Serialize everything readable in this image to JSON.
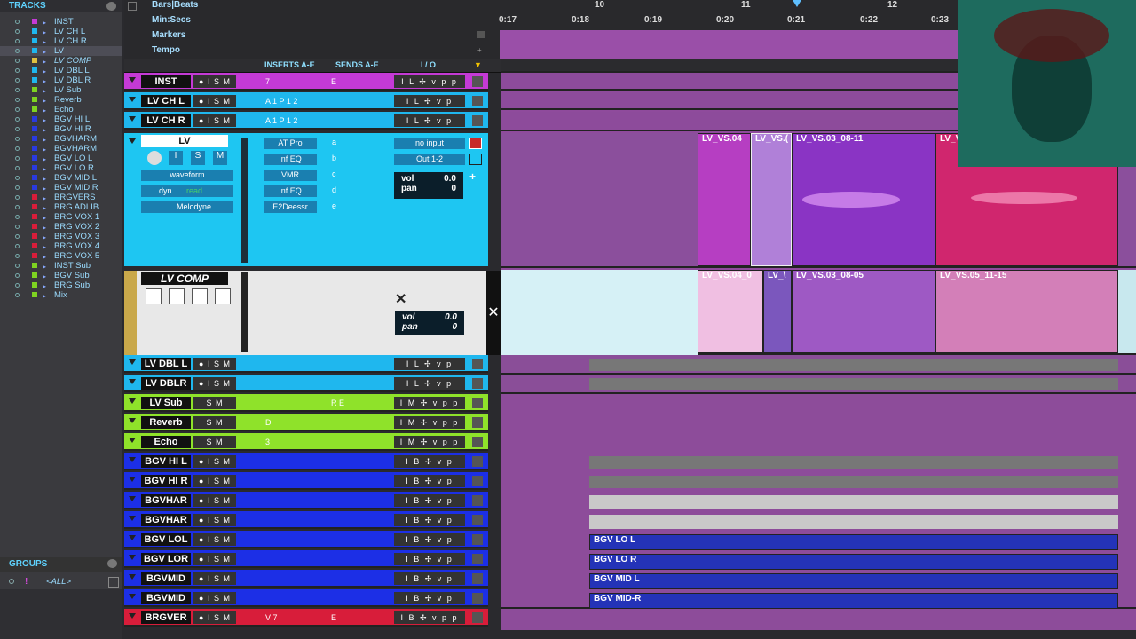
{
  "tracks_panel": {
    "title": "TRACKS",
    "items": [
      {
        "label": "INST",
        "color": "#c43ad6"
      },
      {
        "label": "LV CH L",
        "color": "#1fb7ee"
      },
      {
        "label": "LV CH R",
        "color": "#1fb7ee"
      },
      {
        "label": "LV",
        "color": "#1fb7ee"
      },
      {
        "label": "LV COMP",
        "color": "#e0c040"
      },
      {
        "label": "LV DBL L",
        "color": "#1fb7ee"
      },
      {
        "label": "LV DBL R",
        "color": "#1fb7ee"
      },
      {
        "label": "LV Sub",
        "color": "#7ed321"
      },
      {
        "label": "Reverb",
        "color": "#7ed321"
      },
      {
        "label": "Echo",
        "color": "#7ed321"
      },
      {
        "label": "BGV HI L",
        "color": "#2a3ae0"
      },
      {
        "label": "BGV HI R",
        "color": "#2a3ae0"
      },
      {
        "label": "BGVHARM",
        "color": "#2a3ae0"
      },
      {
        "label": "BGVHARM",
        "color": "#2a3ae0"
      },
      {
        "label": "BGV LO L",
        "color": "#2a3ae0"
      },
      {
        "label": "BGV LO R",
        "color": "#2a3ae0"
      },
      {
        "label": "BGV MID L",
        "color": "#2a3ae0"
      },
      {
        "label": "BGV MID R",
        "color": "#2a3ae0"
      },
      {
        "label": "BRGVERS",
        "color": "#d81d3a"
      },
      {
        "label": "BRG ADLIB",
        "color": "#d81d3a"
      },
      {
        "label": "BRG VOX 1",
        "color": "#d81d3a"
      },
      {
        "label": "BRG VOX 2",
        "color": "#d81d3a"
      },
      {
        "label": "BRG VOX 3",
        "color": "#d81d3a"
      },
      {
        "label": "BRG VOX 4",
        "color": "#d81d3a"
      },
      {
        "label": "BRG VOX 5",
        "color": "#d81d3a"
      },
      {
        "label": "INST Sub",
        "color": "#7ed321"
      },
      {
        "label": "BGV Sub",
        "color": "#7ed321"
      },
      {
        "label": "BRG Sub",
        "color": "#7ed321"
      },
      {
        "label": "Mix",
        "color": "#7ed321"
      }
    ]
  },
  "groups_panel": {
    "title": "GROUPS",
    "all_label": "<ALL>"
  },
  "ruler": {
    "bars_beats": "Bars|Beats",
    "min_secs": "Min:Secs",
    "markers": "Markers",
    "tempo": "Tempo",
    "bars": [
      "10",
      "11",
      "12"
    ],
    "secs": [
      "0:17",
      "0:18",
      "0:19",
      "0:20",
      "0:21",
      "0:22",
      "0:23"
    ]
  },
  "columns": {
    "inserts": "INSERTS A-E",
    "sends": "SENDS A-E",
    "io": "I / O"
  },
  "rows": [
    {
      "name": "INST",
      "color": "#c43ad6",
      "ctl": "● I S M",
      "send": "7",
      "send2": "E",
      "io": "I  L  ✢  v  p  p"
    },
    {
      "name": "LV CH L",
      "color": "#1fb7ee",
      "ctl": "● I S M",
      "send": "A 1 P 1 2",
      "send2": "",
      "io": "I  L  ✢  v  p"
    },
    {
      "name": "LV CH R",
      "color": "#1fb7ee",
      "ctl": "● I S M",
      "send": "A 1 P 1 2",
      "send2": "",
      "io": "I  L  ✢  v  p"
    },
    {
      "name": "LV DBL L",
      "color": "#1fb7ee",
      "ctl": "● I S M",
      "send": "",
      "send2": "",
      "io": "I  L  ✢  v  p"
    },
    {
      "name": "LV DBLR",
      "color": "#1fb7ee",
      "ctl": "● I S M",
      "send": "",
      "send2": "",
      "io": "I  L  ✢  v  p"
    },
    {
      "name": "LV Sub",
      "color": "#8fe22a",
      "ctl": "S M",
      "send": "",
      "send2": "R E",
      "io": "I  M  ✢  v  p  p"
    },
    {
      "name": "Reverb",
      "color": "#8fe22a",
      "ctl": "S M",
      "send": "D",
      "send2": "",
      "io": "I  M  ✢  v  p  p"
    },
    {
      "name": "Echo",
      "color": "#8fe22a",
      "ctl": "S M",
      "send": "3",
      "send2": "",
      "io": "I  M  ✢  v  p  p"
    },
    {
      "name": "BGV HI L",
      "color": "#1c2fe6",
      "ctl": "● I S M",
      "send": "",
      "send2": "",
      "io": "I  B  ✢  v  p"
    },
    {
      "name": "BGV HI R",
      "color": "#1c2fe6",
      "ctl": "● I S M",
      "send": "",
      "send2": "",
      "io": "I  B  ✢  v  p"
    },
    {
      "name": "BGVHAR",
      "color": "#1c2fe6",
      "ctl": "● I S M",
      "send": "",
      "send2": "",
      "io": "I  B  ✢  v  p"
    },
    {
      "name": "BGVHAR",
      "color": "#1c2fe6",
      "ctl": "● I S M",
      "send": "",
      "send2": "",
      "io": "I  B  ✢  v  p"
    },
    {
      "name": "BGV LOL",
      "color": "#1c2fe6",
      "ctl": "● I S M",
      "send": "",
      "send2": "",
      "io": "I  B  ✢  v  p"
    },
    {
      "name": "BGV LOR",
      "color": "#1c2fe6",
      "ctl": "● I S M",
      "send": "",
      "send2": "",
      "io": "I  B  ✢  v  p"
    },
    {
      "name": "BGVMID",
      "color": "#1c2fe6",
      "ctl": "● I S M",
      "send": "",
      "send2": "",
      "io": "I  B  ✢  v  p"
    },
    {
      "name": "BGVMID",
      "color": "#1c2fe6",
      "ctl": "● I S M",
      "send": "",
      "send2": "",
      "io": "I  B  ✢  v  p"
    },
    {
      "name": "BRGVER",
      "color": "#d81d3a",
      "ctl": "● I S M",
      "send": "V 7",
      "send2": "E",
      "io": "I  B  ✢  v  p  p"
    }
  ],
  "lv": {
    "name": "LV",
    "view": "waveform",
    "dyn": "dyn",
    "read": "read",
    "plugin": "Melodyne",
    "inserts": [
      "AT Pro",
      "Inf EQ",
      "VMR",
      "Inf EQ",
      "E2Deessr"
    ],
    "insert_letters": [
      "a",
      "b",
      "c",
      "d",
      "e"
    ],
    "input": "no input",
    "output": "Out 1-2",
    "vol_label": "vol",
    "vol": "0.0",
    "pan_label": "pan",
    "pan": "0"
  },
  "lvcomp": {
    "name": "LV COMP",
    "vol_label": "vol",
    "vol": "0.0",
    "pan_label": "pan",
    "pan": "0"
  },
  "clips": {
    "lv": [
      "LV_VS.04",
      "LV_VS.(",
      "LV_VS.03_08-11",
      "LV_VS"
    ],
    "comp": [
      "LV_VS.04_0",
      "LV_\\",
      "LV_VS.03_08-05",
      "LV_VS.05_11-15"
    ],
    "bgv": [
      "BGV LO L",
      "BGV LO R",
      "BGV MID L",
      "BGV MID-R"
    ]
  }
}
